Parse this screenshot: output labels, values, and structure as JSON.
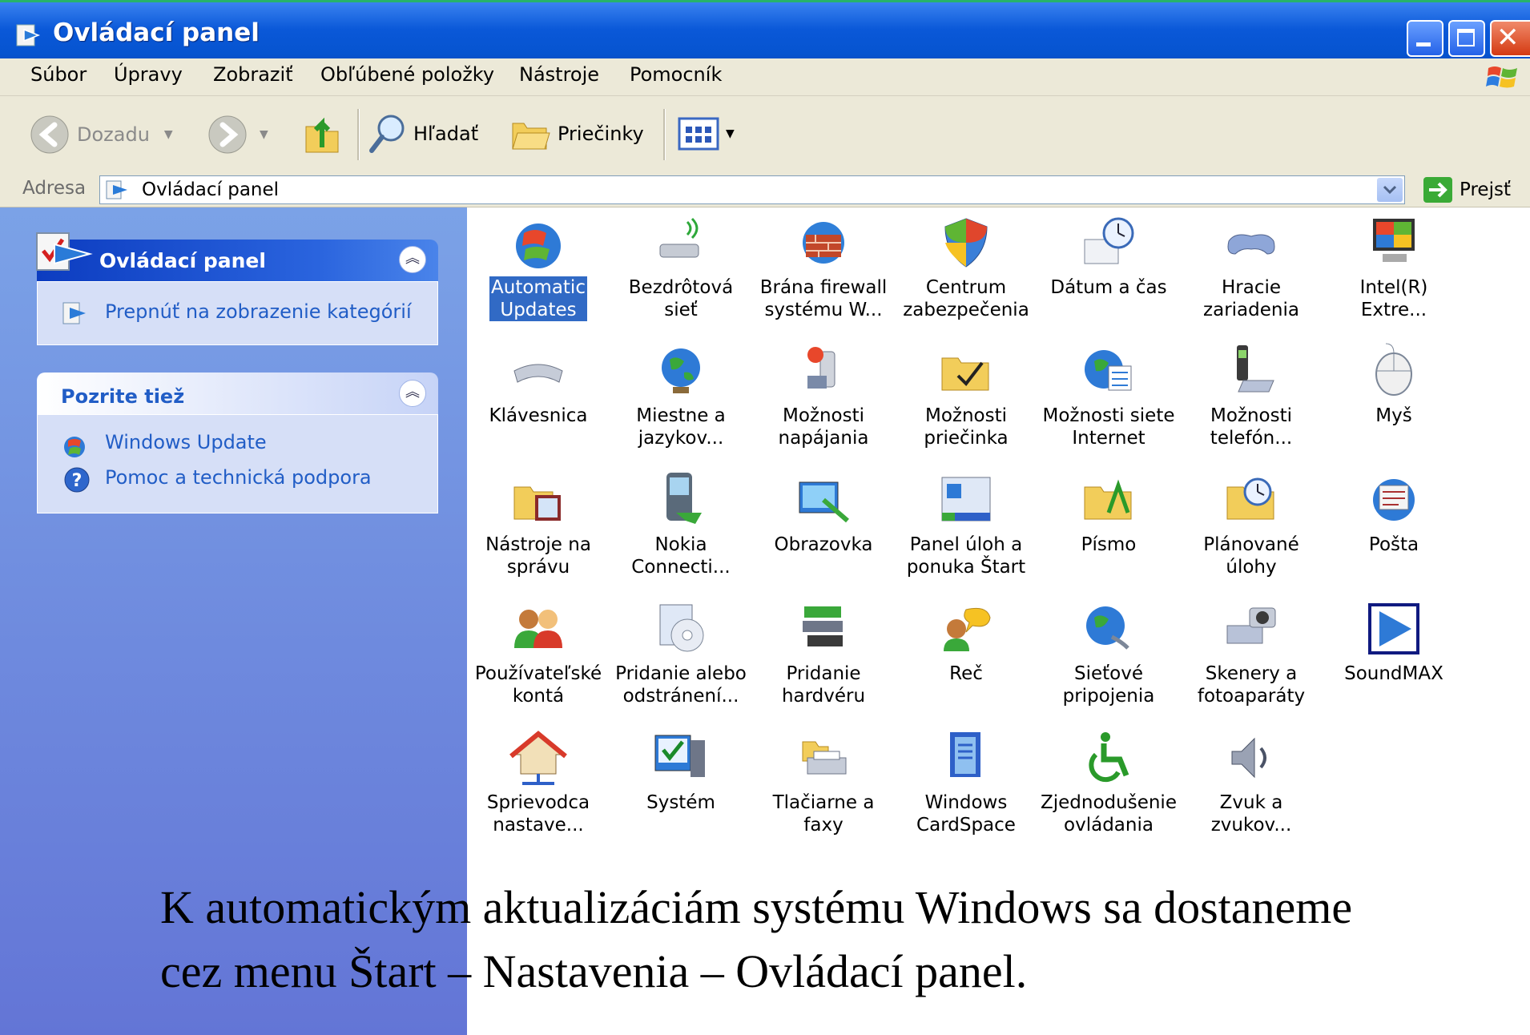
{
  "window": {
    "title": "Ovládací panel",
    "buttons": [
      "minimize",
      "maximize",
      "close"
    ]
  },
  "menu": [
    {
      "label": "Súbor"
    },
    {
      "label": "Úpravy"
    },
    {
      "label": "Zobraziť"
    },
    {
      "label": "Obľúbené položky"
    },
    {
      "label": "Nástroje"
    },
    {
      "label": "Pomocník"
    }
  ],
  "toolbar": {
    "back_label": "Dozadu",
    "search_label": "Hľadať",
    "folders_label": "Priečinky"
  },
  "address": {
    "label": "Adresa",
    "value": "Ovládací panel",
    "go_label": "Prejsť"
  },
  "panels": {
    "control_panel": {
      "title": "Ovládací panel",
      "switch_link": "Prepnúť na zobrazenie kategórií"
    },
    "see_also": {
      "title": "Pozrite tiež",
      "links": [
        "Windows Update",
        "Pomoc a technická podpora"
      ]
    }
  },
  "items": [
    {
      "label": "Automatic\nUpdates",
      "icon": "automatic-updates-icon",
      "selected": true
    },
    {
      "label": "Bezdrôtová\nsieť",
      "icon": "wireless-network-icon"
    },
    {
      "label": "Brána firewall\nsystému W...",
      "icon": "firewall-icon"
    },
    {
      "label": "Centrum\nzabezpečenia",
      "icon": "security-center-icon"
    },
    {
      "label": "Dátum a čas",
      "icon": "date-time-icon"
    },
    {
      "label": "Hracie\nzariadenia",
      "icon": "game-controller-icon"
    },
    {
      "label": "Intel(R)\nExtre...",
      "icon": "intel-graphics-icon"
    },
    {
      "label": "Klávesnica",
      "icon": "keyboard-icon"
    },
    {
      "label": "Miestne a\njazykov...",
      "icon": "regional-globe-icon"
    },
    {
      "label": "Možnosti\nnapájania",
      "icon": "power-options-icon"
    },
    {
      "label": "Možnosti\npriečinka",
      "icon": "folder-options-icon"
    },
    {
      "label": "Možnosti siete\nInternet",
      "icon": "internet-options-icon"
    },
    {
      "label": "Možnosti\ntelefón...",
      "icon": "phone-modem-icon"
    },
    {
      "label": "Myš",
      "icon": "mouse-icon"
    },
    {
      "label": "Nástroje na\nsprávu",
      "icon": "admin-tools-icon"
    },
    {
      "label": "Nokia\nConnecti...",
      "icon": "nokia-phone-icon"
    },
    {
      "label": "Obrazovka",
      "icon": "display-icon"
    },
    {
      "label": "Panel úloh a\nponuka Štart",
      "icon": "taskbar-icon"
    },
    {
      "label": "Písmo",
      "icon": "fonts-folder-icon"
    },
    {
      "label": "Plánované\núlohy",
      "icon": "scheduled-tasks-icon"
    },
    {
      "label": "Pošta",
      "icon": "mail-icon"
    },
    {
      "label": "Používateľské\nkontá",
      "icon": "user-accounts-icon"
    },
    {
      "label": "Pridanie alebo\nodstránení...",
      "icon": "add-remove-programs-icon"
    },
    {
      "label": "Pridanie\nhardvéru",
      "icon": "add-hardware-icon"
    },
    {
      "label": "Reč",
      "icon": "speech-icon"
    },
    {
      "label": "Sieťové\npripojenia",
      "icon": "network-connections-icon"
    },
    {
      "label": "Skenery a\nfotoaparáty",
      "icon": "scanner-camera-icon"
    },
    {
      "label": "SoundMAX",
      "icon": "soundmax-icon"
    },
    {
      "label": "Sprievodca\nnastave...",
      "icon": "network-setup-wizard-icon"
    },
    {
      "label": "Systém",
      "icon": "system-icon"
    },
    {
      "label": "Tlačiarne a\nfaxy",
      "icon": "printer-fax-icon"
    },
    {
      "label": "Windows\nCardSpace",
      "icon": "cardspace-icon"
    },
    {
      "label": "Zjednodušenie\novládania",
      "icon": "accessibility-icon"
    },
    {
      "label": "Zvuk a\nzvukov...",
      "icon": "sound-icon"
    }
  ],
  "caption": {
    "line1": "K automatickým aktualizáciám systému Windows sa dostaneme",
    "line2": "cez menu Štart –  Nastavenia – Ovládací panel."
  },
  "colors": {
    "title_bar": "#0a58d8",
    "left_panel": "#7ba2e7",
    "selection": "#316ac5",
    "link": "#215dc6"
  }
}
